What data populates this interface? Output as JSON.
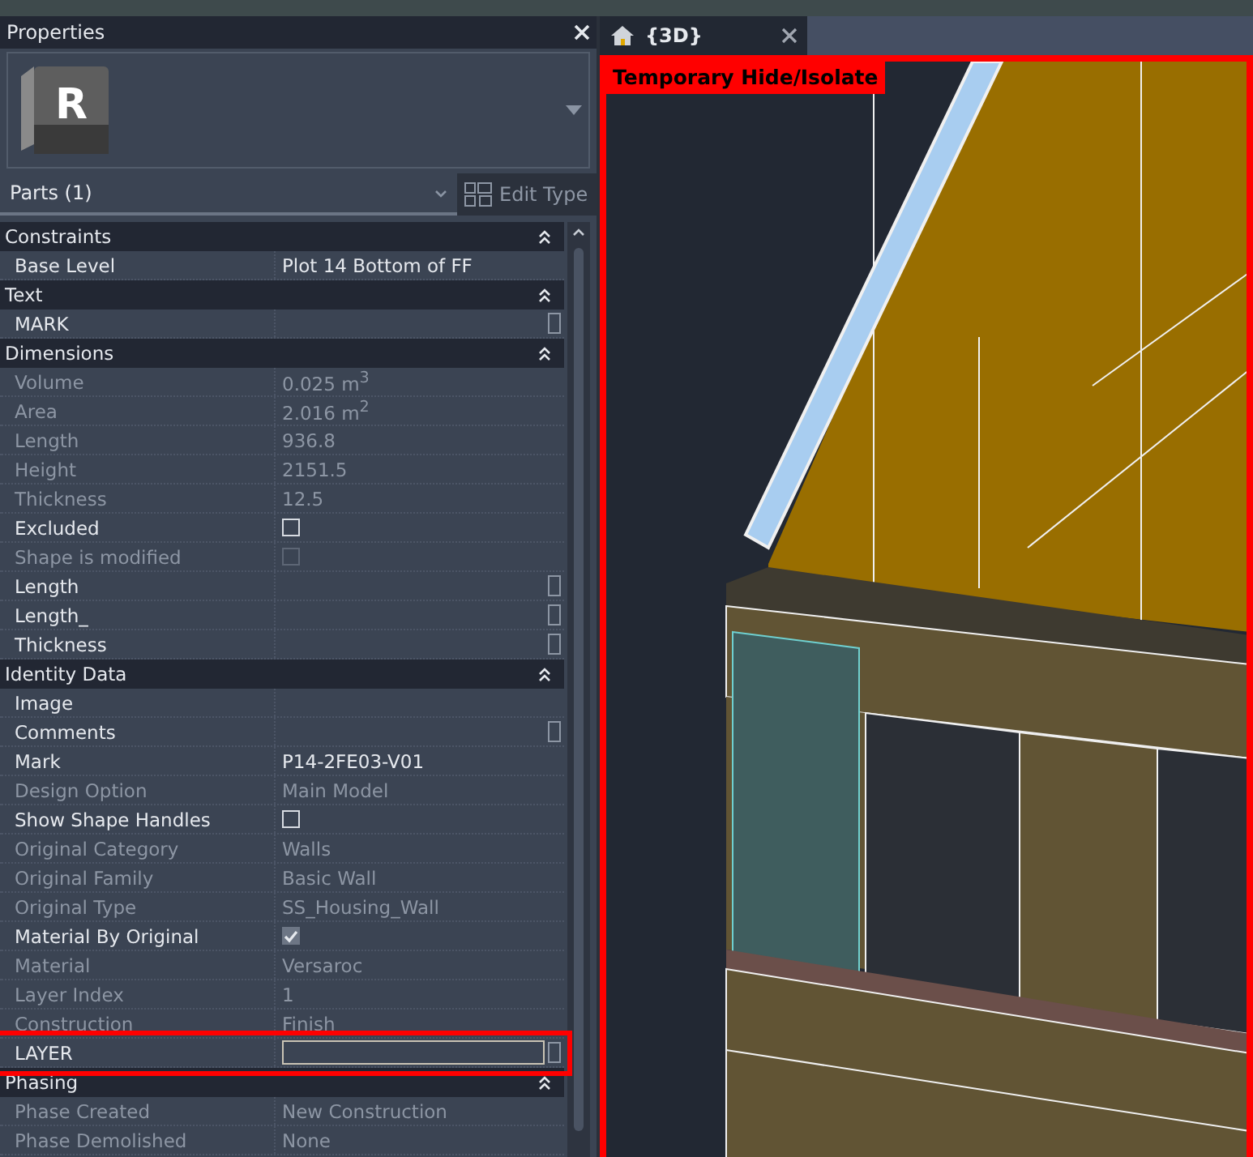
{
  "properties_panel": {
    "title": "Properties",
    "type_selector": {
      "logo_letter": "R"
    },
    "filter": "Parts (1)",
    "edit_type": "Edit Type",
    "rows": [
      {
        "kind": "group",
        "label": "Constraints",
        "expanded": true
      },
      {
        "kind": "value",
        "label": "Base Level",
        "value": "Plot 14 Bottom of FF",
        "dim": false,
        "param_button": false
      },
      {
        "kind": "group",
        "label": "Text",
        "expanded": true
      },
      {
        "kind": "value",
        "label": "MARK",
        "value": "",
        "dim": false,
        "param_button": true
      },
      {
        "kind": "group",
        "label": "Dimensions",
        "expanded": true
      },
      {
        "kind": "value",
        "label": "Volume",
        "value": "0.025 m$^{3}$",
        "dim": true,
        "param_button": false
      },
      {
        "kind": "value",
        "label": "Area",
        "value": "2.016 m$^{2}$",
        "dim": true,
        "param_button": false
      },
      {
        "kind": "value",
        "label": "Length",
        "value": "936.8",
        "dim": true,
        "param_button": false
      },
      {
        "kind": "value",
        "label": "Height",
        "value": "2151.5",
        "dim": true,
        "param_button": false
      },
      {
        "kind": "value",
        "label": "Thickness",
        "value": "12.5",
        "dim": true,
        "param_button": false
      },
      {
        "kind": "checkbox",
        "label": "Excluded",
        "checked": false,
        "dim": false
      },
      {
        "kind": "checkbox",
        "label": "Shape is modified",
        "checked": false,
        "dim": true
      },
      {
        "kind": "value",
        "label": "Length",
        "value": "",
        "dim": false,
        "param_button": true
      },
      {
        "kind": "value",
        "label": "Length_",
        "value": "",
        "dim": false,
        "param_button": true
      },
      {
        "kind": "value",
        "label": "Thickness",
        "value": "",
        "dim": false,
        "param_button": true
      },
      {
        "kind": "group",
        "label": "Identity Data",
        "expanded": true
      },
      {
        "kind": "value",
        "label": "Image",
        "value": "",
        "dim": false,
        "param_button": false
      },
      {
        "kind": "value",
        "label": "Comments",
        "value": "",
        "dim": false,
        "param_button": true
      },
      {
        "kind": "value",
        "label": "Mark",
        "value": "P14-2FE03-V01",
        "dim": false,
        "param_button": false
      },
      {
        "kind": "value",
        "label": "Design Option",
        "value": "Main Model",
        "dim": true,
        "param_button": false
      },
      {
        "kind": "checkbox",
        "label": "Show Shape Handles",
        "checked": false,
        "dim": false
      },
      {
        "kind": "value",
        "label": "Original Category",
        "value": "Walls",
        "dim": true,
        "param_button": false
      },
      {
        "kind": "value",
        "label": "Original Family",
        "value": "Basic Wall",
        "dim": true,
        "param_button": false
      },
      {
        "kind": "value",
        "label": "Original Type",
        "value": "SS_Housing_Wall",
        "dim": true,
        "param_button": false
      },
      {
        "kind": "checkbox",
        "label": "Material By Original",
        "checked": true,
        "dim": false
      },
      {
        "kind": "value",
        "label": "Material",
        "value": "Versaroc",
        "dim": true,
        "param_button": false
      },
      {
        "kind": "value",
        "label": "Layer Index",
        "value": "1",
        "dim": true,
        "param_button": false
      },
      {
        "kind": "value",
        "label": "Construction",
        "value": "Finish",
        "dim": true,
        "param_button": false
      },
      {
        "kind": "input",
        "label": "LAYER",
        "value": "",
        "dim": false,
        "param_button": true,
        "highlighted": true
      },
      {
        "kind": "group",
        "label": "Phasing",
        "expanded": true
      },
      {
        "kind": "value",
        "label": "Phase Created",
        "value": "New Construction",
        "dim": true,
        "param_button": false
      },
      {
        "kind": "value",
        "label": "Phase Demolished",
        "value": "None",
        "dim": true,
        "param_button": false
      }
    ]
  },
  "view": {
    "tab": {
      "title": "{3D}",
      "selected": true
    },
    "overlay_label": "Temporary Hide/Isolate",
    "temporary_isolate": true
  }
}
